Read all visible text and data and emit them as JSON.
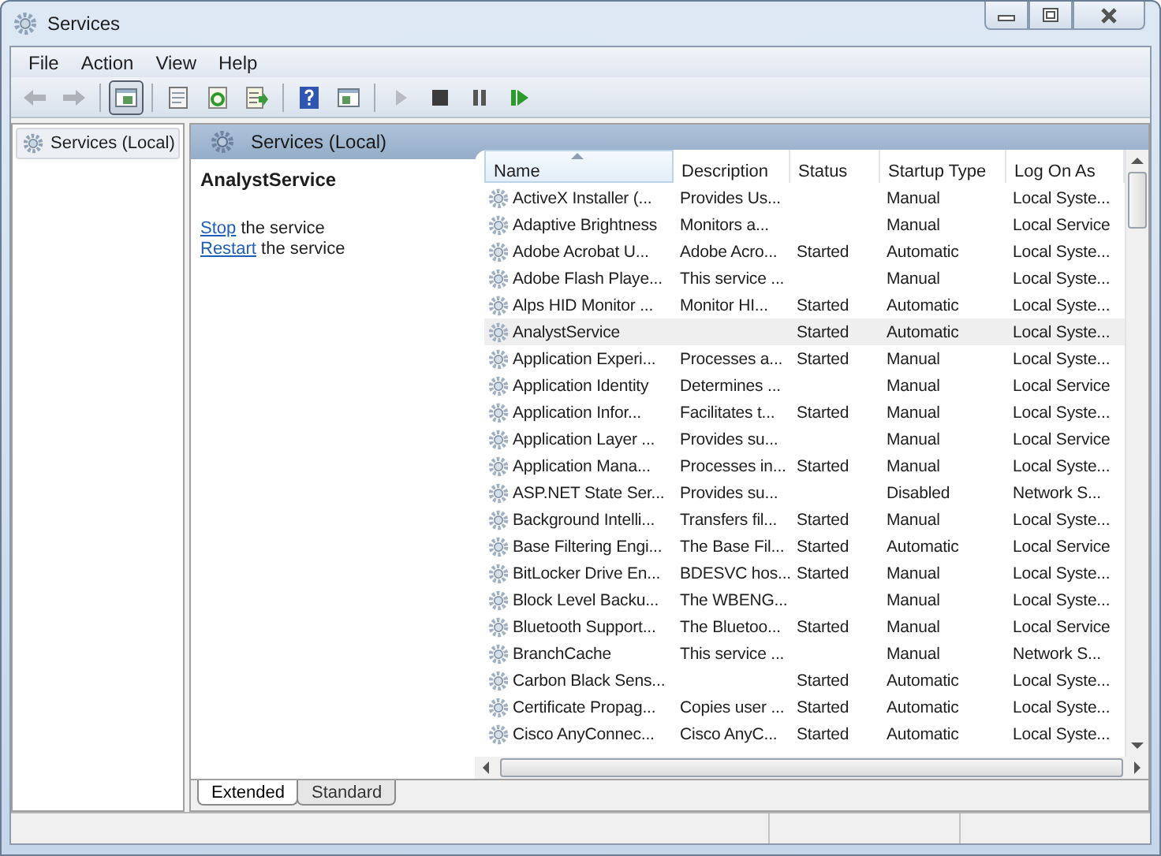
{
  "window": {
    "title": "Services"
  },
  "menu": [
    "File",
    "Action",
    "View",
    "Help"
  ],
  "toolbar": [
    {
      "kind": "back",
      "pressed": false,
      "disabled": true
    },
    {
      "kind": "forward",
      "pressed": false,
      "disabled": true
    },
    {
      "kind": "console-tree",
      "pressed": true,
      "disabled": false
    },
    {
      "kind": "properties",
      "pressed": false,
      "disabled": false
    },
    {
      "kind": "refresh",
      "pressed": false,
      "disabled": false
    },
    {
      "kind": "export",
      "pressed": false,
      "disabled": false
    },
    {
      "kind": "help",
      "pressed": false,
      "disabled": false
    },
    {
      "kind": "action-pane",
      "pressed": false,
      "disabled": false
    },
    {
      "kind": "start",
      "pressed": false,
      "disabled": true
    },
    {
      "kind": "stop",
      "pressed": false,
      "disabled": false
    },
    {
      "kind": "pause",
      "pressed": false,
      "disabled": false
    },
    {
      "kind": "resume",
      "pressed": false,
      "disabled": false
    }
  ],
  "tree": {
    "items": [
      {
        "label": "Services (Local)",
        "selected": true
      }
    ]
  },
  "pane_header": "Services (Local)",
  "details": {
    "title": "AnalystService",
    "actions": [
      {
        "link": "Stop",
        "text": "the service"
      },
      {
        "link": "Restart",
        "text": "the service"
      }
    ]
  },
  "table": {
    "columns": [
      {
        "label": "Name",
        "sorted": true
      },
      {
        "label": "Description",
        "sorted": false
      },
      {
        "label": "Status",
        "sorted": false
      },
      {
        "label": "Startup Type",
        "sorted": false
      },
      {
        "label": "Log On As",
        "sorted": false
      }
    ],
    "rows": [
      {
        "cells": [
          "ActiveX Installer (...",
          "Provides Us...",
          "",
          "Manual",
          "Local Syste..."
        ],
        "selected": false
      },
      {
        "cells": [
          "Adaptive Brightness",
          "Monitors a...",
          "",
          "Manual",
          "Local Service"
        ],
        "selected": false
      },
      {
        "cells": [
          "Adobe Acrobat U...",
          "Adobe Acro...",
          "Started",
          "Automatic",
          "Local Syste..."
        ],
        "selected": false
      },
      {
        "cells": [
          "Adobe Flash Playe...",
          "This service ...",
          "",
          "Manual",
          "Local Syste..."
        ],
        "selected": false
      },
      {
        "cells": [
          "Alps HID Monitor ...",
          "Monitor HI...",
          "Started",
          "Automatic",
          "Local Syste..."
        ],
        "selected": false
      },
      {
        "cells": [
          "AnalystService",
          "",
          "Started",
          "Automatic",
          "Local Syste..."
        ],
        "selected": true
      },
      {
        "cells": [
          "Application Experi...",
          "Processes a...",
          "Started",
          "Manual",
          "Local Syste..."
        ],
        "selected": false
      },
      {
        "cells": [
          "Application Identity",
          "Determines ...",
          "",
          "Manual",
          "Local Service"
        ],
        "selected": false
      },
      {
        "cells": [
          "Application Infor...",
          "Facilitates t...",
          "Started",
          "Manual",
          "Local Syste..."
        ],
        "selected": false
      },
      {
        "cells": [
          "Application Layer ...",
          "Provides su...",
          "",
          "Manual",
          "Local Service"
        ],
        "selected": false
      },
      {
        "cells": [
          "Application Mana...",
          "Processes in...",
          "Started",
          "Manual",
          "Local Syste..."
        ],
        "selected": false
      },
      {
        "cells": [
          "ASP.NET State Ser...",
          "Provides su...",
          "",
          "Disabled",
          "Network S..."
        ],
        "selected": false
      },
      {
        "cells": [
          "Background Intelli...",
          "Transfers fil...",
          "Started",
          "Manual",
          "Local Syste..."
        ],
        "selected": false
      },
      {
        "cells": [
          "Base Filtering Engi...",
          "The Base Fil...",
          "Started",
          "Automatic",
          "Local Service"
        ],
        "selected": false
      },
      {
        "cells": [
          "BitLocker Drive En...",
          "BDESVC hos...",
          "Started",
          "Manual",
          "Local Syste..."
        ],
        "selected": false
      },
      {
        "cells": [
          "Block Level Backu...",
          "The WBENG...",
          "",
          "Manual",
          "Local Syste..."
        ],
        "selected": false
      },
      {
        "cells": [
          "Bluetooth Support...",
          "The Bluetoo...",
          "Started",
          "Manual",
          "Local Service"
        ],
        "selected": false
      },
      {
        "cells": [
          "BranchCache",
          "This service ...",
          "",
          "Manual",
          "Network S..."
        ],
        "selected": false
      },
      {
        "cells": [
          "Carbon Black Sens...",
          "",
          "Started",
          "Automatic",
          "Local Syste..."
        ],
        "selected": false
      },
      {
        "cells": [
          "Certificate Propag...",
          "Copies user ...",
          "Started",
          "Automatic",
          "Local Syste..."
        ],
        "selected": false
      },
      {
        "cells": [
          "Cisco AnyConnec...",
          "Cisco AnyC...",
          "Started",
          "Automatic",
          "Local Syste..."
        ],
        "selected": false
      }
    ]
  },
  "tabs": [
    {
      "label": "Extended",
      "selected": true
    },
    {
      "label": "Standard",
      "selected": false
    }
  ]
}
